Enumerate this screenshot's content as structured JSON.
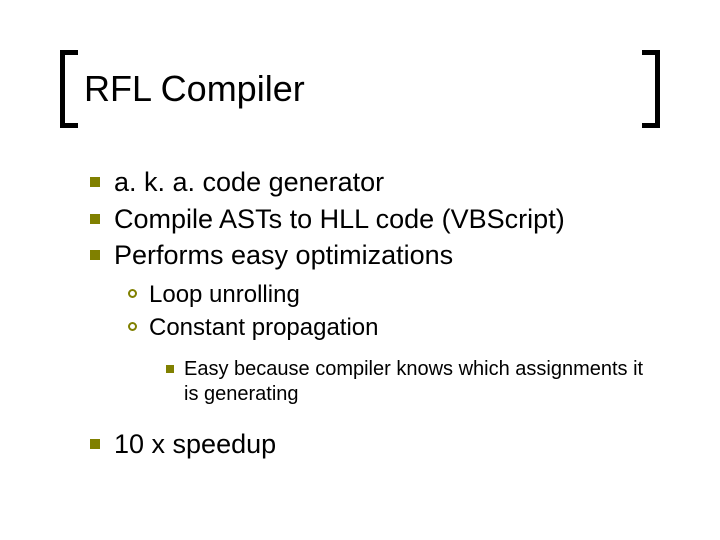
{
  "title": "RFL Compiler",
  "bullets": {
    "lvl1": [
      "a. k. a. code generator",
      "Compile ASTs to HLL code (VBScript)",
      "Performs easy optimizations"
    ],
    "lvl2": [
      "Loop unrolling",
      "Constant propagation"
    ],
    "lvl3": [
      "Easy because compiler knows which assignments it is generating"
    ],
    "lvl1_tail": [
      "10 x speedup"
    ]
  }
}
